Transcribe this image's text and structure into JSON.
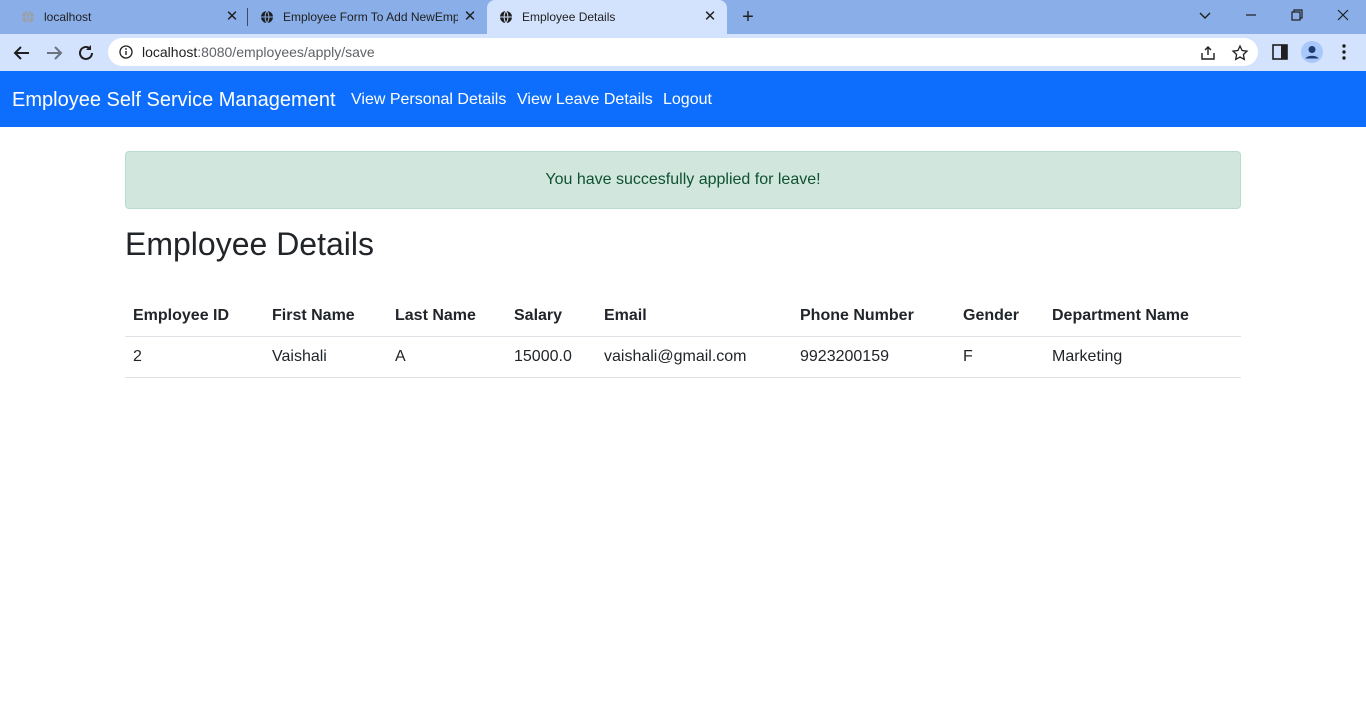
{
  "browser": {
    "tabs": [
      {
        "title": "localhost",
        "active": false
      },
      {
        "title": "Employee Form To Add NewEmp",
        "active": false
      },
      {
        "title": "Employee Details",
        "active": true
      }
    ],
    "url_host": "localhost",
    "url_path": ":8080/employees/apply/save",
    "icons": [
      "globe-icon",
      "close-icon",
      "plus-icon",
      "back-icon",
      "forward-icon",
      "reload-icon",
      "info-icon",
      "share-icon",
      "star-icon",
      "sidepanel-icon",
      "profile-icon",
      "menu-icon",
      "chevron-down-icon",
      "minimize-icon",
      "restore-icon",
      "close-window-icon"
    ]
  },
  "navbar": {
    "brand": "Employee Self Service Management",
    "links": [
      {
        "label": "View Personal Details"
      },
      {
        "label": "View Leave Details"
      },
      {
        "label": "Logout"
      }
    ],
    "color": "#0d6efd"
  },
  "alert": {
    "message": "You have succesfully applied for leave!",
    "bg_color": "#d1e7dd",
    "text_color": "#0f5132"
  },
  "page": {
    "title": "Employee Details"
  },
  "table": {
    "headers": [
      "Employee ID",
      "First Name",
      "Last Name",
      "Salary",
      "Email",
      "Phone Number",
      "Gender",
      "Department Name"
    ],
    "rows": [
      [
        "2",
        "Vaishali",
        "A",
        "15000.0",
        "vaishali@gmail.com",
        "9923200159",
        "F",
        "Marketing"
      ]
    ]
  }
}
